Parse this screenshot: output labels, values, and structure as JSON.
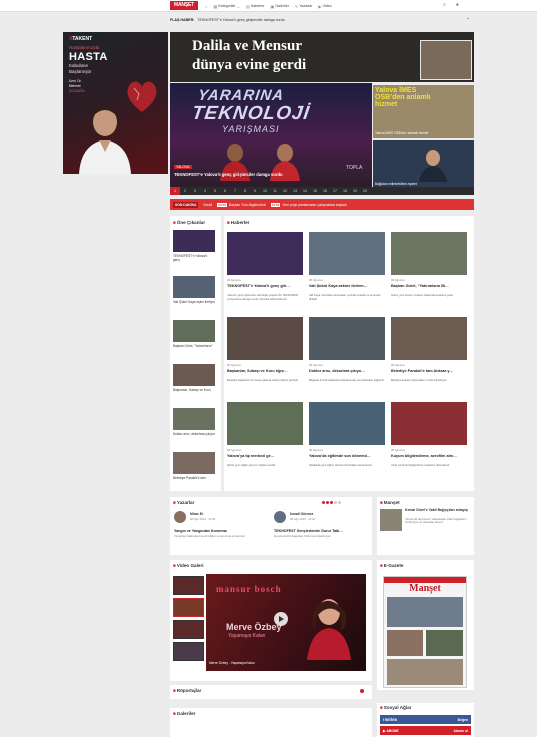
{
  "header": {
    "logo": "MANŞET",
    "nav": [
      {
        "icon": "home-icon",
        "label": ""
      },
      {
        "icon": "grid-icon",
        "label": "Kategoriler"
      },
      {
        "icon": "newspaper-icon",
        "label": "Haberler"
      },
      {
        "icon": "gallery-icon",
        "label": "Galeriler"
      },
      {
        "icon": "pen-icon",
        "label": "Yazarlar"
      },
      {
        "icon": "video-icon",
        "label": "Video"
      }
    ],
    "right_icons": [
      "search-icon",
      "user-icon"
    ]
  },
  "breaking": {
    "label": "FLAŞ HABER:",
    "text": "TEKNOFEST’e Yalova’lı genç girişimciler damga vurdu"
  },
  "ad": {
    "brand_a": "A",
    "brand_b": "TAKENT",
    "line1": "Hastalarımızda",
    "line2": "HASTA",
    "line3": "Kabulüne",
    "line4": "Başlamıştır",
    "doctor1": "Uzm. Dr.",
    "doctor2": "Mehmet",
    "doctor3": "KOCAAĞA"
  },
  "banner": {
    "line1": "Dalila ve Mensur",
    "line2": "dünya evine gerdi"
  },
  "slider": {
    "title1": "YARARINA",
    "title2": "TEKNOLOJİ",
    "title3": "YARIŞMASI",
    "tag": "YALOVA",
    "caption": "TEKNOFEST’e Yalova’lı genç girişimciler damga vurdu",
    "right_text": "TOPLA",
    "pages": [
      "1",
      "2",
      "3",
      "4",
      "5",
      "6",
      "7",
      "8",
      "9",
      "10",
      "11",
      "12",
      "13",
      "14",
      "15",
      "16",
      "17",
      "18",
      "19",
      "20"
    ],
    "active_page": "1"
  },
  "side_news": [
    {
      "title": "Yalova İMES OSB’den anlamlı hizmet",
      "caption": "Yalova İMES OSB’den anlamlı hizmet"
    },
    {
      "title": "",
      "caption": "Bağlıdan milletvekiline ziyaret"
    }
  ],
  "ticker": {
    "label": "SON DAKİKA",
    "items": [
      {
        "time": "",
        "text": "Kendi"
      },
      {
        "time": "14:50",
        "text": "Başkan Tutu bilgilendirdi"
      },
      {
        "time": "14:50",
        "text": "Yeni proje planlamaları çalışmalara başladı"
      }
    ]
  },
  "left_col": {
    "title": "Öne Çıkanlar",
    "items": [
      "TEKNOFEST’e Yalova’lı genç",
      "Vali Şükrü Kaya eşine ilerliyor",
      "Başkan Gürel, “Yatırımların”",
      "Başkanlar, Subaşı ve Koru",
      "Doktor arısı, dekorlara çıkıyor",
      "Belediye Paraküt’e tam"
    ]
  },
  "news_grid": {
    "title": "Haberler",
    "items": [
      {
        "date": "08 Ağustos",
        "title": "TEKNOFEST’e Yalova’lı genç giri…",
        "desc": "Yalova’lı genç öğrenciler teknolojik projeleri ile TEKNOFEST yarışmasına damga vurdu, birincilik ödülü elde etti."
      },
      {
        "date": "08 Ağustos",
        "title": "Vali Şükrü Kaya askine ilerlem…",
        "desc": "Vali Kaya, ilimizdeki çalışmaları yerinde inceledi ve sorunları dinledi."
      },
      {
        "date": "08 Ağustos",
        "title": "Başkan Gürel, “Yatırımların Bi…",
        "desc": "Gürel, yeni dönem projeleri hakkında açıklama yaptı."
      },
      {
        "date": "08 Ağustos",
        "title": "Başkanlar, Subaşı ve Koru öğre…",
        "desc": "Belediye başkanları bir araya gelerek ortak projeleri görüştü."
      },
      {
        "date": "08 Ağustos",
        "title": "Doktor arısı, dekorlara çıkıyo…",
        "desc": "Bölgede arıcılık faaliyetleri kapsamında yeni destekler sağlandı."
      },
      {
        "date": "08 Ağustos",
        "title": "Belediye Paraküt’e tam Ankara y…",
        "desc": "Belediye ekipleri çalışmalarını hızla sürdürüyor."
      },
      {
        "date": "08 Ağustos",
        "title": "Yalova’ya tıp merkezi ge…",
        "desc": "Şehre yeni sağlık yatırımı müjdesi verildi."
      },
      {
        "date": "08 Ağustos",
        "title": "Yalova’da eğitimde son dönemd…",
        "desc": "Okullarda yeni eğitim dönemi hazırlıkları tamamlandı."
      },
      {
        "date": "08 Ağustos",
        "title": "Kuyum bilgilendirme, aerofilm alm…",
        "desc": "Yerel esnaf ile bilgilendirme toplantısı düzenlendi."
      }
    ]
  },
  "authors": {
    "title": "Yazarlar",
    "items": [
      {
        "name": "Mirac Er",
        "date": "08 Ağu 2023 - 14:00",
        "title": "Yangın ve Yangından Korunma",
        "desc": "Yangınlar hakkında önemli bilgiler ve korunma yöntemleri."
      },
      {
        "name": "İsmail Gürmez",
        "date": "08 Ağu 2023 - 14:00",
        "title": "TEKNOFEST Gençlerimizle Gurur Tabl…",
        "desc": "Gençlerimizin başarıları bizleri gururlandırıyor."
      }
    ]
  },
  "right_news": {
    "title": "Manşet",
    "headline": "Kemal Gürel’e Vakıf Bağışçıları anlayışı",
    "desc": "Yalova’da hayırsever vatandaşlar vakıf bağışlarını sürdürüyor ve destekler artıyor."
  },
  "video": {
    "title": "Video Galeri",
    "main_title1": "mansur bosch",
    "main_title2": "Merve Özbey",
    "main_title3": "Yaşamaya Kalan",
    "caption": "Merve Özbey - Yaşamaya Kalan"
  },
  "egazete": {
    "title": "E-Gazete",
    "masthead": "Manşet"
  },
  "reports": {
    "title": "Röportajlar"
  },
  "galleries": {
    "title": "Galeriler"
  },
  "social": {
    "title": "Sosyal Ağlar",
    "facebook": "BEĞEN",
    "facebook_count": "Beğen",
    "youtube": "ABONE",
    "youtube_count": "Abone ol"
  }
}
